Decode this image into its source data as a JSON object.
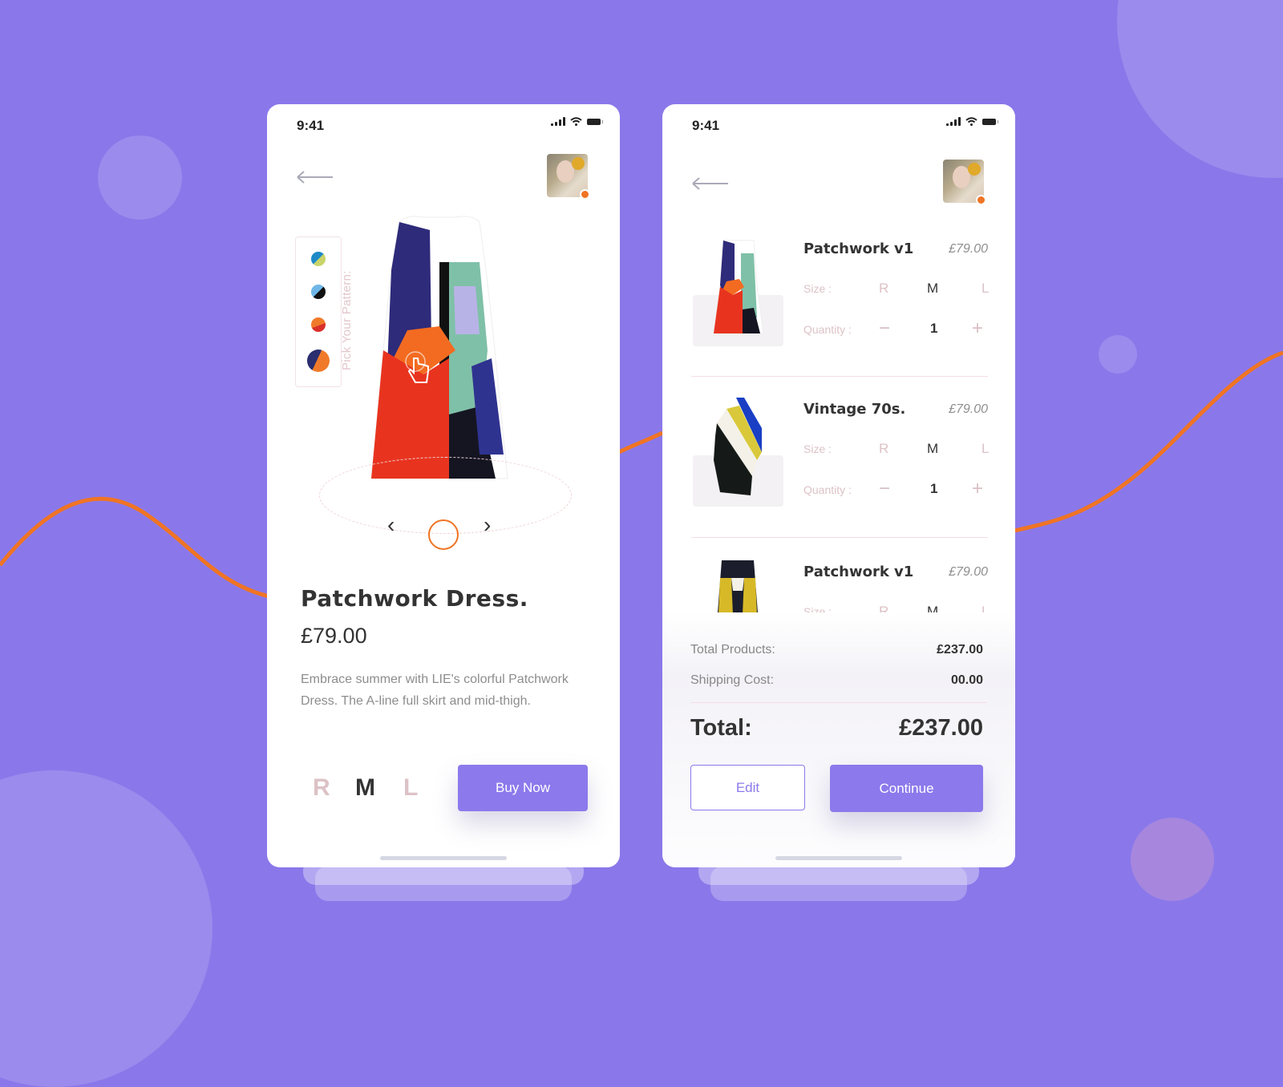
{
  "theme": {
    "background": "#8a78ea",
    "accent": "#8c79ec",
    "orange": "#f07424",
    "text_dark": "#333333",
    "text_muted": "#8d8d8d",
    "size_inactive": "#dcc2c6"
  },
  "product_screen": {
    "status_time": "9:41",
    "back_icon": "arrow-left-icon",
    "pattern_picker": {
      "label": "Pick Your Pattern:",
      "swatches": [
        {
          "name": "swatch-blue-yellow",
          "colors": [
            "#1f8ac7",
            "#c9d46a"
          ]
        },
        {
          "name": "swatch-lightblue-black",
          "colors": [
            "#6fb6e8",
            "#111111"
          ]
        },
        {
          "name": "swatch-orange-red",
          "colors": [
            "#f07a2a",
            "#d9302a"
          ]
        },
        {
          "name": "swatch-navy-orange",
          "colors": [
            "#2a2d6e",
            "#f07a2a"
          ],
          "selected": true
        }
      ]
    },
    "carousel": {
      "prev_icon": "chevron-left-icon",
      "next_icon": "chevron-right-icon",
      "prev": "‹",
      "next": "›"
    },
    "title": "Patchwork Dress.",
    "price": "£79.00",
    "description": "Embrace summer with LIE's colorful Patchwork Dress. The A-line full skirt and mid-thigh.",
    "sizes": [
      {
        "label": "R",
        "selected": false
      },
      {
        "label": "M",
        "selected": true
      },
      {
        "label": "L",
        "selected": false
      }
    ],
    "buy_button": "Buy Now"
  },
  "cart_screen": {
    "status_time": "9:41",
    "items": [
      {
        "name": "Patchwork v1",
        "price": "£79.00",
        "size_label": "Size :",
        "sizes": [
          "R",
          "M",
          "L"
        ],
        "selected_size": "M",
        "quantity_label": "Quantity :",
        "quantity": "1",
        "minus": "−",
        "plus": "+"
      },
      {
        "name": "Vintage 70s.",
        "price": "£79.00",
        "size_label": "Size :",
        "sizes": [
          "R",
          "M",
          "L"
        ],
        "selected_size": "M",
        "quantity_label": "Quantity :",
        "quantity": "1",
        "minus": "−",
        "plus": "+"
      },
      {
        "name": "Patchwork v1",
        "price": "£79.00",
        "size_label": "Size :",
        "sizes": [
          "R",
          "M",
          "L"
        ],
        "selected_size": "M"
      }
    ],
    "summary": {
      "total_products_label": "Total Products:",
      "total_products_value": "£237.00",
      "shipping_label": "Shipping Cost:",
      "shipping_value": "00.00",
      "total_label": "Total:",
      "total_value": "£237.00"
    },
    "edit_button": "Edit",
    "continue_button": "Continue"
  }
}
